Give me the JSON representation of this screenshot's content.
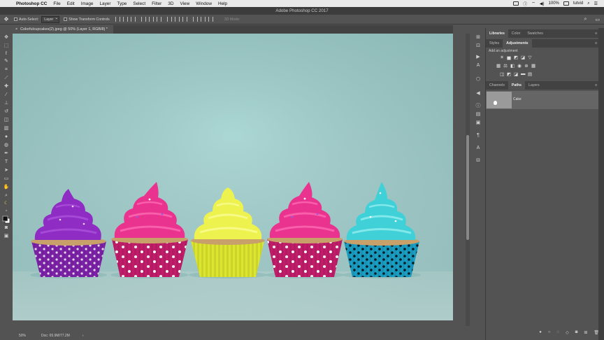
{
  "menubar": {
    "app_name": "Photoshop CC",
    "items": [
      "File",
      "Edit",
      "Image",
      "Layer",
      "Type",
      "Select",
      "Filter",
      "3D",
      "View",
      "Window",
      "Help"
    ],
    "battery": "100%",
    "username": "tutvid"
  },
  "window": {
    "title": "Adobe Photoshop CC 2017"
  },
  "options_bar": {
    "auto_select_label": "Auto-Select:",
    "auto_select_value": "Layer",
    "show_transform_label": "Show Transform Controls",
    "mode_3d_label": "3D Mode:"
  },
  "document": {
    "tab_title": "Colorfulcupcakes(2).jpeg @ 50% (Layer 1, RGB/8) *"
  },
  "status": {
    "zoom": "50%",
    "doc_info": "Doc: 65.9M/77.2M"
  },
  "panels": {
    "top_tabs": [
      "Libraries",
      "Color",
      "Swatches"
    ],
    "mid_tabs": [
      "Styles",
      "Adjustments"
    ],
    "adjustments_label": "Add an adjustment",
    "paths_tabs": [
      "Channels",
      "Paths",
      "Layers"
    ],
    "path_name": "Cake"
  },
  "colors": {
    "accent_purple": "#8a2fc0",
    "accent_pink": "#e0368f",
    "accent_yellow": "#e6ec3a",
    "accent_teal": "#3fcad4",
    "background": "#a9d6d4"
  }
}
